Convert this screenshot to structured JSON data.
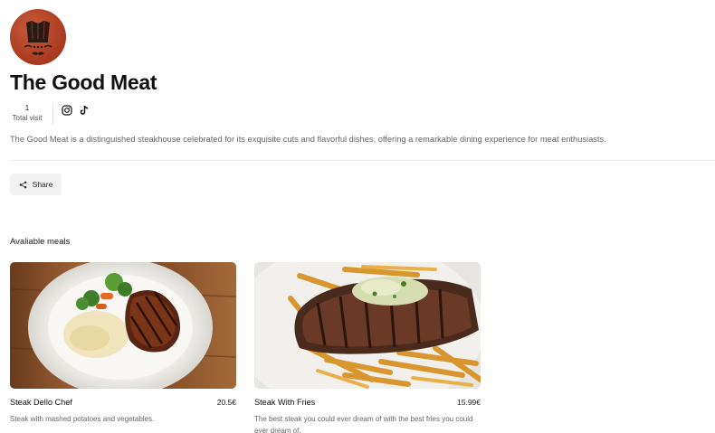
{
  "restaurant": {
    "name": "The Good Meat",
    "description": "The Good Meat is a distinguished steakhouse celebrated for its exquisite cuts and flavorful dishes, offering a remarkable dining experience for meat enthusiasts.",
    "visit_count": "1",
    "visit_label": "Total visit",
    "logo_icon": "chef-logo",
    "brand_color": "#b1432a"
  },
  "social": [
    {
      "icon": "instagram-icon"
    },
    {
      "icon": "tiktok-icon"
    }
  ],
  "share": {
    "label": "Share",
    "icon": "share-icon"
  },
  "meals_section": {
    "title": "Avaliable meals"
  },
  "meals": [
    {
      "name": "Steak Dello Chef",
      "price": "20.5€",
      "description": "Steak with mashed potatoes and vegetables."
    },
    {
      "name": "Steak With Fries",
      "price": "15.99€",
      "description": "The best steak you could ever dream of with the best fries you could ever dream of."
    }
  ]
}
